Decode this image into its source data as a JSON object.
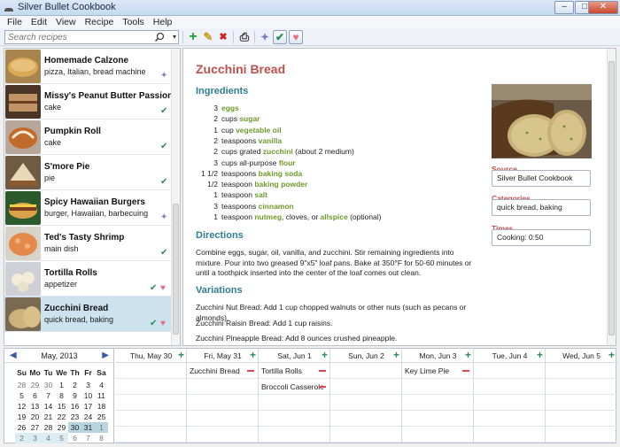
{
  "window": {
    "title": "Silver Bullet Cookbook",
    "minimize": "–",
    "maximize": "□",
    "close": "✕"
  },
  "menu": [
    "File",
    "Edit",
    "View",
    "Recipe",
    "Tools",
    "Help"
  ],
  "search": {
    "placeholder": "Search recipes",
    "dropdown": "▾"
  },
  "toolbar": {
    "add": "+",
    "edit": "✎",
    "delete": "✖",
    "print": "⎙",
    "pin": "✦",
    "check": "✔",
    "heart": "♥"
  },
  "colors": {
    "accent_title": "#c0504d",
    "section": "#2e7f93",
    "ingredient": "#6f9a2c",
    "pin": "#7f80c8",
    "check": "#2e8b57",
    "heart": "#e07082"
  },
  "recipes": [
    {
      "name": "Homemade Calzone",
      "tags": "pizza, Italian, bread machine",
      "status": [
        "pin"
      ]
    },
    {
      "name": "Missy's Peanut Butter Passion Cake",
      "tags": "cake",
      "status": [
        "check"
      ]
    },
    {
      "name": "Pumpkin Roll",
      "tags": "cake",
      "status": [
        "check"
      ]
    },
    {
      "name": "S'more Pie",
      "tags": "pie",
      "status": [
        "check"
      ]
    },
    {
      "name": "Spicy Hawaiian Burgers",
      "tags": "burger, Hawaiian, barbecuing",
      "status": [
        "pin"
      ]
    },
    {
      "name": "Ted's Tasty Shrimp",
      "tags": "main dish",
      "status": [
        "check"
      ]
    },
    {
      "name": "Tortilla Rolls",
      "tags": "appetizer",
      "status": [
        "check",
        "heart"
      ]
    },
    {
      "name": "Zucchini Bread",
      "tags": "quick bread, baking",
      "status": [
        "check",
        "heart"
      ],
      "selected": true
    }
  ],
  "detail": {
    "title": "Zucchini Bread",
    "ingredients_heading": "Ingredients",
    "ingredients": [
      {
        "qty": "3",
        "pre": "",
        "name": "eggs",
        "post": ""
      },
      {
        "qty": "2",
        "pre": "cups",
        "name": "sugar",
        "post": ""
      },
      {
        "qty": "1",
        "pre": "cup",
        "name": "vegetable oil",
        "post": ""
      },
      {
        "qty": "2",
        "pre": "teaspoons",
        "name": "vanilla",
        "post": ""
      },
      {
        "qty": "2",
        "pre": "cups grated",
        "name": "zucchini",
        "post": "(about 2 medium)"
      },
      {
        "qty": "3",
        "pre": "cups all-purpose",
        "name": "flour",
        "post": ""
      },
      {
        "qty": "1 1/2",
        "pre": "teaspoons",
        "name": "baking soda",
        "post": ""
      },
      {
        "qty": "1/2",
        "pre": "teaspoon",
        "name": "baking powder",
        "post": ""
      },
      {
        "qty": "1",
        "pre": "teaspoon",
        "name": "salt",
        "post": ""
      },
      {
        "qty": "3",
        "pre": "teaspoons",
        "name": "cinnamon",
        "post": ""
      },
      {
        "qty": "1",
        "pre": "teaspoon",
        "name": "nutmeg",
        "post": ", cloves, or",
        "name2": "allspice",
        "post2": "(optional)"
      }
    ],
    "directions_heading": "Directions",
    "directions": "Combine eggs, sugar, oil, vanilla, and zucchini. Stir remaining ingredients into mixture. Pour into two greased 9\"x5\" loaf pans. Bake at 350°F for 50-60 minutes or until a toothpick inserted into the center of the loaf comes out clean.",
    "variations_heading": "Variations",
    "variations": [
      "Zucchini Nut Bread: Add 1 cup chopped walnuts or other nuts (such as pecans or almonds).",
      "Zucchini Raisin Bread: Add 1 cup raisins.",
      "Zucchini Pineapple Bread: Add 8 ounces crushed pineapple."
    ],
    "source_label": "Source",
    "source": "Silver Bullet Cookbook",
    "categories_label": "Categories",
    "categories": "quick bread, baking",
    "times_label": "Times",
    "times": "Cooking: 0:50"
  },
  "calendar": {
    "month": "May, 2013",
    "prev": "◀",
    "next": "▶",
    "dow": [
      "Su",
      "Mo",
      "Tu",
      "We",
      "Th",
      "Fr",
      "Sa"
    ],
    "weeks": [
      [
        "28",
        "29",
        "30",
        "1",
        "2",
        "3",
        "4"
      ],
      [
        "5",
        "6",
        "7",
        "8",
        "9",
        "10",
        "11"
      ],
      [
        "12",
        "13",
        "14",
        "15",
        "16",
        "17",
        "18"
      ],
      [
        "19",
        "20",
        "21",
        "22",
        "23",
        "24",
        "25"
      ],
      [
        "26",
        "27",
        "28",
        "29",
        "30",
        "31",
        "1"
      ],
      [
        "2",
        "3",
        "4",
        "5",
        "6",
        "7",
        "8"
      ]
    ],
    "days": [
      {
        "label": "Thu, May 30",
        "entries": []
      },
      {
        "label": "Fri, May 31",
        "entries": [
          "Zucchini Bread"
        ]
      },
      {
        "label": "Sat, Jun 1",
        "entries": [
          "Tortilla Rolls",
          "Broccoli Casserole"
        ]
      },
      {
        "label": "Sun, Jun 2",
        "entries": []
      },
      {
        "label": "Mon, Jun 3",
        "entries": [
          "Key Lime Pie"
        ]
      },
      {
        "label": "Tue, Jun 4",
        "entries": []
      },
      {
        "label": "Wed, Jun 5",
        "entries": []
      }
    ],
    "add_symbol": "+"
  }
}
